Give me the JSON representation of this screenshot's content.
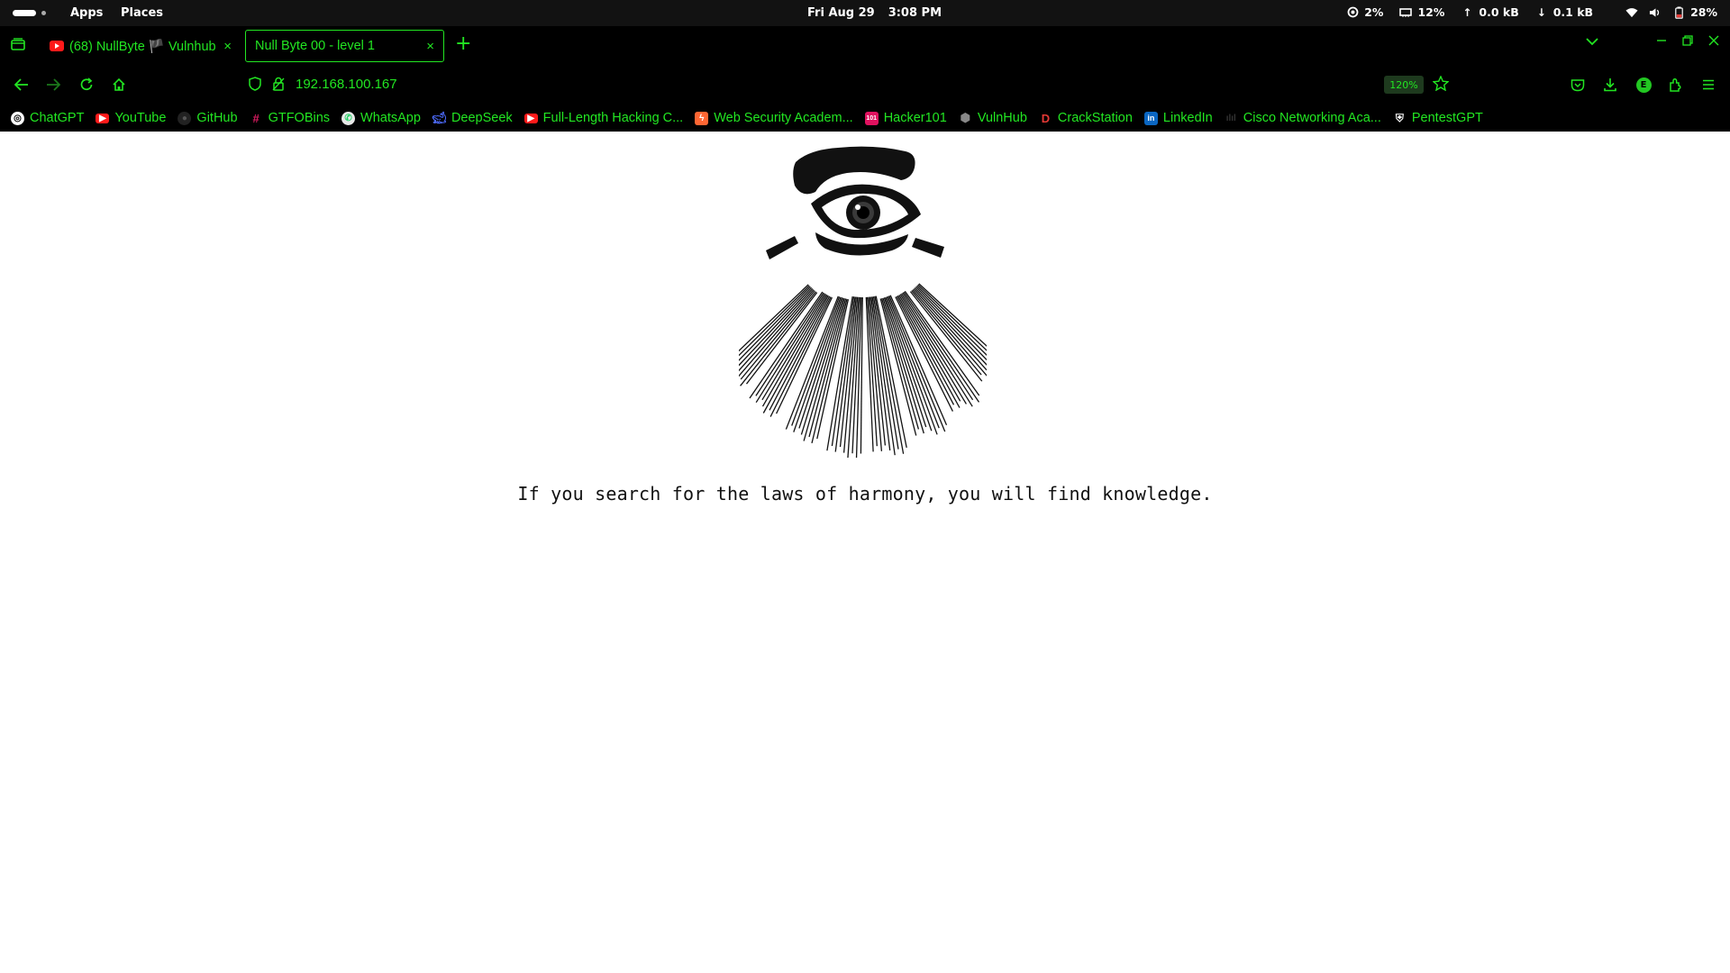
{
  "topbar": {
    "apps_label": "Apps",
    "places_label": "Places",
    "date": "Fri Aug 29",
    "time": "3:08 PM",
    "cpu": "2%",
    "memory": "12%",
    "upload": "0.0 kB",
    "download": "0.1 kB",
    "battery": "28%"
  },
  "tabs": [
    {
      "title": "(68) NullByte 🏴 Vulnhub",
      "favicon": "youtube-icon",
      "active": false
    },
    {
      "title": "Null Byte 00 - level 1",
      "active": true
    }
  ],
  "navbar": {
    "url": "192.168.100.167",
    "zoom": "120%"
  },
  "bookmarks": [
    {
      "label": "ChatGPT",
      "icon": "chatgpt-icon",
      "color": "#ffffff"
    },
    {
      "label": "YouTube",
      "icon": "youtube-icon",
      "color": "#ff1a1a"
    },
    {
      "label": "GitHub",
      "icon": "github-icon",
      "color": "#222222"
    },
    {
      "label": "GTFOBins",
      "icon": "gtfobins-icon",
      "color": "#c2185b"
    },
    {
      "label": "WhatsApp",
      "icon": "whatsapp-icon",
      "color": "#e8e8e8"
    },
    {
      "label": "DeepSeek",
      "icon": "deepseek-icon",
      "color": "#4d6bfe"
    },
    {
      "label": "Full-Length Hacking C...",
      "icon": "youtube-icon",
      "color": "#ff1a1a"
    },
    {
      "label": "Web Security Academ...",
      "icon": "portswigger-icon",
      "color": "#ff6633"
    },
    {
      "label": "Hacker101",
      "icon": "hacker101-icon",
      "color": "#e0115f"
    },
    {
      "label": "VulnHub",
      "icon": "vulnhub-icon",
      "color": "#555555"
    },
    {
      "label": "CrackStation",
      "icon": "crackstation-icon",
      "color": "#000000"
    },
    {
      "label": "LinkedIn",
      "icon": "linkedin-icon",
      "color": "#0a66c2"
    },
    {
      "label": "Cisco Networking Aca...",
      "icon": "cisco-icon",
      "color": "#111111"
    },
    {
      "label": "PentestGPT",
      "icon": "pentestgpt-icon",
      "color": "#000000"
    }
  ],
  "page": {
    "message": "If you search for the laws of harmony, you will find knowledge."
  }
}
